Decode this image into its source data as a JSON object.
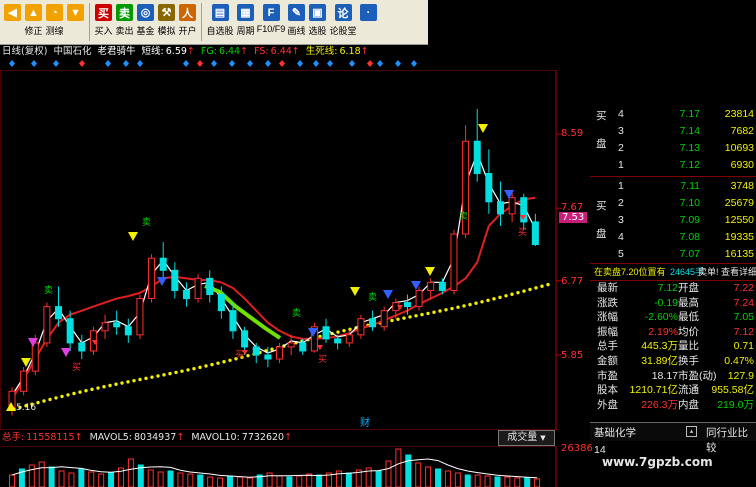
{
  "toolbar": {
    "items": [
      {
        "label": "",
        "icon": "back-icon",
        "color": "#f2a200"
      },
      {
        "label": "修正",
        "icon": "up-arrow-icon",
        "color": "#f2a200"
      },
      {
        "label": "测缐",
        "icon": "clock-icon",
        "color": "#f2a200"
      },
      {
        "label": "",
        "icon": "down-arrow-icon",
        "color": "#f2a200"
      },
      {
        "label": "买入",
        "icon": "buy-icon",
        "color": "#cc0000",
        "text": "买"
      },
      {
        "label": "卖出",
        "icon": "sell-icon",
        "color": "#009900",
        "text": "卖"
      },
      {
        "label": "基金",
        "icon": "fund-icon",
        "color": "#1c5fb8",
        "text": "◎"
      },
      {
        "label": "模拟",
        "icon": "hammer-icon",
        "color": "#886600",
        "text": "⚒"
      },
      {
        "label": "开户",
        "icon": "person-icon",
        "color": "#cc6600",
        "text": "人"
      },
      {
        "label": "自选股",
        "icon": "watchlist-icon",
        "color": "#1c5fb8",
        "text": "▤"
      },
      {
        "label": "周期",
        "icon": "period-icon",
        "color": "#1c5fb8",
        "text": "▦"
      },
      {
        "label": "F10/F9",
        "icon": "f10-icon",
        "color": "#1c5fb8",
        "text": "F"
      },
      {
        "label": "画线",
        "icon": "pen-icon",
        "color": "#1c5fb8",
        "text": "✎"
      },
      {
        "label": "选股",
        "icon": "select-stock-icon",
        "color": "#1c5fb8",
        "text": "▣"
      },
      {
        "label": "论股堂",
        "icon": "forum-icon",
        "color": "#1c5fb8",
        "text": "论"
      },
      {
        "label": "",
        "icon": "more-icon",
        "color": "#1c5fb8",
        "text": "·"
      }
    ]
  },
  "title_bar": {
    "mode": "日线(复权)",
    "stock": "中国石化",
    "indicator": "老君骑牛",
    "short_label": "短线:",
    "short_value": "6.59",
    "fg_label": "FG:",
    "fg_value": "6.44",
    "fs_label": "FS:",
    "fs_value": "6.44",
    "life_label": "生死线:",
    "life_value": "6.18",
    "arrow": "↑"
  },
  "price_axis": {
    "labels": [
      "8.59",
      "7.67",
      "7.53",
      "6.77",
      "5.85"
    ],
    "low_marker": "5.16"
  },
  "chart_labels": {
    "sell": "卖",
    "buy": "买",
    "finance": "财"
  },
  "chart_data": {
    "type": "candlestick",
    "ylim": [
      5.0,
      8.9
    ],
    "candles": [
      {
        "o": 5.2,
        "h": 5.45,
        "l": 5.1,
        "c": 5.4
      },
      {
        "o": 5.4,
        "h": 5.7,
        "l": 5.35,
        "c": 5.65
      },
      {
        "o": 5.65,
        "h": 6.1,
        "l": 5.6,
        "c": 6.0
      },
      {
        "o": 6.0,
        "h": 6.5,
        "l": 5.95,
        "c": 6.45
      },
      {
        "o": 6.45,
        "h": 6.7,
        "l": 6.2,
        "c": 6.3
      },
      {
        "o": 6.3,
        "h": 6.4,
        "l": 5.9,
        "c": 6.0
      },
      {
        "o": 6.0,
        "h": 6.1,
        "l": 5.8,
        "c": 5.9
      },
      {
        "o": 5.9,
        "h": 6.2,
        "l": 5.85,
        "c": 6.15
      },
      {
        "o": 6.15,
        "h": 6.35,
        "l": 6.05,
        "c": 6.25
      },
      {
        "o": 6.25,
        "h": 6.4,
        "l": 6.1,
        "c": 6.2
      },
      {
        "o": 6.2,
        "h": 6.3,
        "l": 6.0,
        "c": 6.1
      },
      {
        "o": 6.1,
        "h": 6.6,
        "l": 6.05,
        "c": 6.55
      },
      {
        "o": 6.55,
        "h": 7.1,
        "l": 6.5,
        "c": 7.05
      },
      {
        "o": 7.05,
        "h": 7.25,
        "l": 6.8,
        "c": 6.9
      },
      {
        "o": 6.9,
        "h": 7.0,
        "l": 6.55,
        "c": 6.65
      },
      {
        "o": 6.65,
        "h": 6.75,
        "l": 6.45,
        "c": 6.55
      },
      {
        "o": 6.55,
        "h": 6.85,
        "l": 6.5,
        "c": 6.8
      },
      {
        "o": 6.8,
        "h": 6.9,
        "l": 6.5,
        "c": 6.6
      },
      {
        "o": 6.6,
        "h": 6.7,
        "l": 6.3,
        "c": 6.4
      },
      {
        "o": 6.4,
        "h": 6.5,
        "l": 6.05,
        "c": 6.15
      },
      {
        "o": 6.15,
        "h": 6.2,
        "l": 5.85,
        "c": 5.95
      },
      {
        "o": 5.95,
        "h": 6.0,
        "l": 5.75,
        "c": 5.85
      },
      {
        "o": 5.85,
        "h": 5.95,
        "l": 5.7,
        "c": 5.8
      },
      {
        "o": 5.8,
        "h": 6.0,
        "l": 5.75,
        "c": 5.95
      },
      {
        "o": 5.95,
        "h": 6.1,
        "l": 5.85,
        "c": 6.0
      },
      {
        "o": 6.0,
        "h": 6.05,
        "l": 5.85,
        "c": 5.9
      },
      {
        "o": 5.9,
        "h": 6.25,
        "l": 5.88,
        "c": 6.2
      },
      {
        "o": 6.2,
        "h": 6.3,
        "l": 6.0,
        "c": 6.05
      },
      {
        "o": 6.05,
        "h": 6.1,
        "l": 5.92,
        "c": 6.0
      },
      {
        "o": 6.0,
        "h": 6.15,
        "l": 5.95,
        "c": 6.1
      },
      {
        "o": 6.1,
        "h": 6.35,
        "l": 6.05,
        "c": 6.3
      },
      {
        "o": 6.3,
        "h": 6.4,
        "l": 6.15,
        "c": 6.2
      },
      {
        "o": 6.2,
        "h": 6.45,
        "l": 6.15,
        "c": 6.4
      },
      {
        "o": 6.4,
        "h": 6.55,
        "l": 6.3,
        "c": 6.5
      },
      {
        "o": 6.5,
        "h": 6.6,
        "l": 6.35,
        "c": 6.45
      },
      {
        "o": 6.45,
        "h": 6.7,
        "l": 6.4,
        "c": 6.65
      },
      {
        "o": 6.65,
        "h": 6.8,
        "l": 6.55,
        "c": 6.75
      },
      {
        "o": 6.75,
        "h": 6.8,
        "l": 6.6,
        "c": 6.65
      },
      {
        "o": 6.65,
        "h": 7.4,
        "l": 6.6,
        "c": 7.35
      },
      {
        "o": 7.35,
        "h": 8.7,
        "l": 7.3,
        "c": 8.5
      },
      {
        "o": 8.5,
        "h": 8.9,
        "l": 8.0,
        "c": 8.1
      },
      {
        "o": 8.1,
        "h": 8.4,
        "l": 7.6,
        "c": 7.75
      },
      {
        "o": 7.75,
        "h": 8.0,
        "l": 7.45,
        "c": 7.6
      },
      {
        "o": 7.6,
        "h": 7.9,
        "l": 7.5,
        "c": 7.8
      },
      {
        "o": 7.8,
        "h": 7.85,
        "l": 7.4,
        "c": 7.5
      },
      {
        "o": 7.5,
        "h": 7.6,
        "l": 7.2,
        "c": 7.22
      }
    ]
  },
  "quotes": {
    "sell_side_label": [
      "买",
      "盘"
    ],
    "sell_levels": [
      {
        "level": "4",
        "price": "7.17",
        "vol": "23814"
      },
      {
        "level": "3",
        "price": "7.14",
        "vol": "7682"
      },
      {
        "level": "2",
        "price": "7.13",
        "vol": "10693"
      },
      {
        "level": "1",
        "price": "7.12",
        "vol": "6930"
      }
    ],
    "buy_side_label": [
      "买",
      "盘"
    ],
    "buy_levels": [
      {
        "level": "1",
        "price": "7.11",
        "vol": "3748"
      },
      {
        "level": "2",
        "price": "7.10",
        "vol": "25679"
      },
      {
        "level": "3",
        "price": "7.09",
        "vol": "12550"
      },
      {
        "level": "4",
        "price": "7.08",
        "vol": "19335"
      },
      {
        "level": "5",
        "price": "7.07",
        "vol": "16135"
      }
    ],
    "order_line": {
      "left": "在卖盘7.20位置有",
      "mid": "24645手",
      "right": "卖单! 查看详细"
    },
    "stats": [
      {
        "l1": "最新",
        "v1": "7.12",
        "l2": "开盘",
        "v2": "7.22"
      },
      {
        "l1": "涨跌",
        "v1": "-0.19",
        "l2": "最高",
        "v2": "7.24"
      },
      {
        "l1": "涨幅",
        "v1": "-2.60%",
        "l2": "最低",
        "v2": "7.05"
      },
      {
        "l1": "振幅",
        "v1": "2.19%",
        "l2": "均价",
        "v2": "7.12"
      },
      {
        "l1": "总手",
        "v1": "445.3万",
        "l2": "量比",
        "v2": "0.71"
      },
      {
        "l1": "金额",
        "v1": "31.89亿",
        "l2": "换手",
        "v2": "0.47%"
      },
      {
        "l1": "市盈",
        "v1": "18.17",
        "l2": "市盈(动)",
        "v2": "127.9"
      },
      {
        "l1": "股本",
        "v1": "1210.71亿",
        "l2": "流通",
        "v2": "955.58亿"
      },
      {
        "l1": "外盘",
        "v1": "226.3万",
        "l2": "内盘",
        "v2": "219.0万"
      }
    ],
    "bottom_tabs": {
      "left": "基础化学",
      "right": "同行业比较"
    },
    "bottom_value": "14"
  },
  "volume_bar": {
    "total_label": "总手:",
    "total_value": "11558115",
    "ma5_label": "MAVOL5:",
    "ma5_value": "8034937",
    "ma10_label": "MAVOL10:",
    "ma10_value": "7732620",
    "dropdown": "成交量",
    "axis_value": "26386"
  },
  "watermark": "www.7gpzb.com",
  "colors": {
    "up": "#ff3030",
    "down": "#00e0e0",
    "short_line": "#ffffff",
    "life_line": "#ff3030",
    "trend_dots": "#f0f000",
    "fg": "#00d000",
    "fs": "#ff3030"
  }
}
